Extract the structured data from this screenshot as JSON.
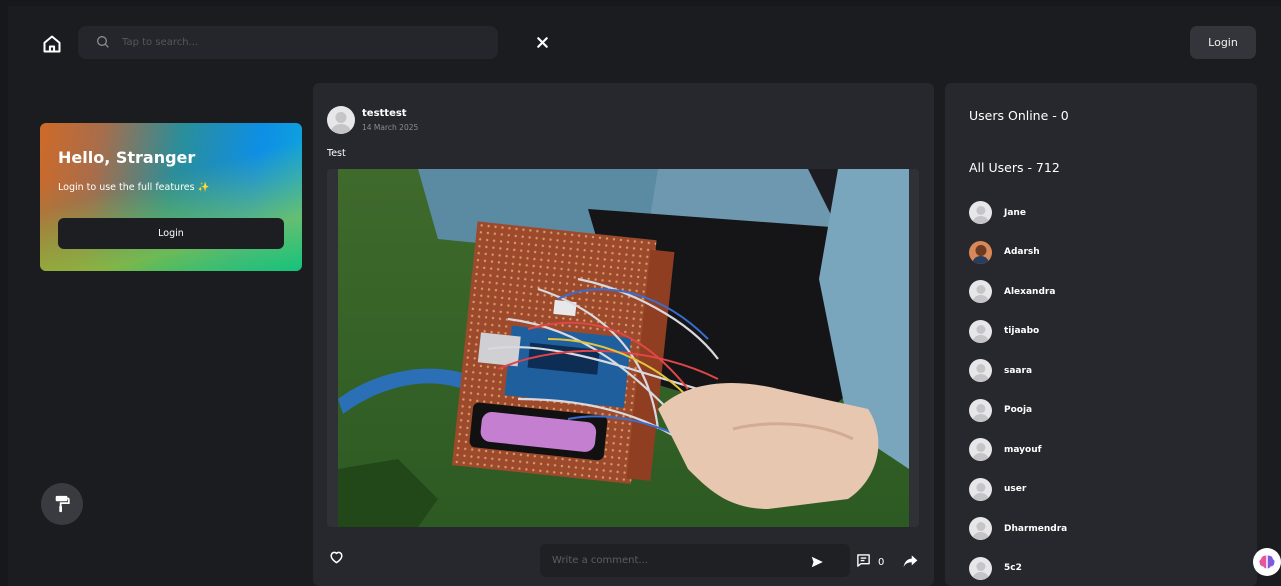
{
  "header": {
    "search_placeholder": "Tap to search...",
    "login_label": "Login"
  },
  "hello_card": {
    "title": "Hello, Stranger",
    "subtitle": "Login to use the full features ✨",
    "login_label": "Login"
  },
  "post": {
    "username": "testtest",
    "date": "14 March 2025",
    "caption": "Test",
    "comment_placeholder": "Write a comment...",
    "comment_count": "0"
  },
  "users_panel": {
    "online_title": "Users Online - 0",
    "all_title": "All Users - 712",
    "users": [
      {
        "name": "Jane",
        "avatar": "default"
      },
      {
        "name": "Adarsh",
        "avatar": "photo"
      },
      {
        "name": "Alexandra",
        "avatar": "default"
      },
      {
        "name": "tijaabo",
        "avatar": "default"
      },
      {
        "name": "saara",
        "avatar": "default"
      },
      {
        "name": "Pooja",
        "avatar": "default"
      },
      {
        "name": "mayouf",
        "avatar": "default"
      },
      {
        "name": "user",
        "avatar": "default"
      },
      {
        "name": "Dharmendra",
        "avatar": "default"
      },
      {
        "name": "5c2",
        "avatar": "default"
      }
    ]
  },
  "icons": {
    "home": "home-icon",
    "search": "search-icon",
    "clear": "close-icon",
    "brush": "paint-roller-icon",
    "like": "heart-icon",
    "send": "send-icon",
    "comments": "comment-icon",
    "share": "share-icon",
    "assistant": "brain-icon"
  },
  "colors": {
    "background": "#1b1c20",
    "panel": "#27282d",
    "search_bg": "#25262b",
    "button_bg": "#34353b"
  }
}
